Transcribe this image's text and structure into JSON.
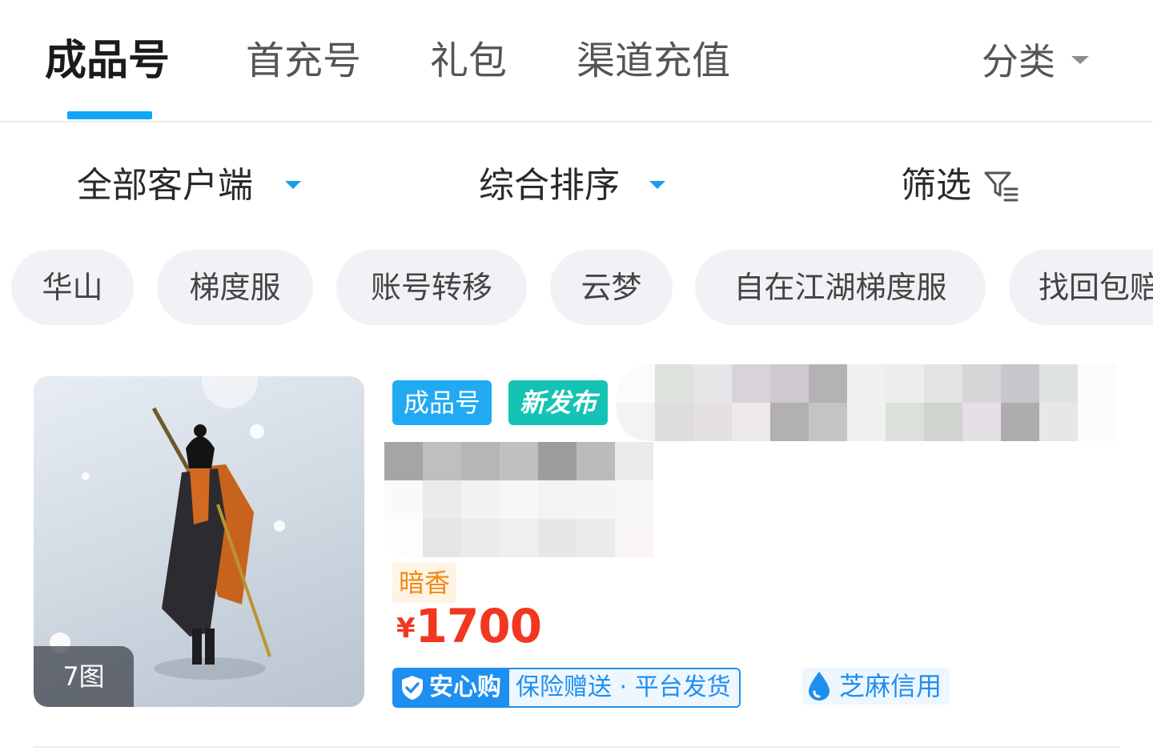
{
  "tabs": [
    {
      "label": "成品号",
      "active": true
    },
    {
      "label": "首充号",
      "active": false
    },
    {
      "label": "礼包",
      "active": false
    },
    {
      "label": "渠道充值",
      "active": false
    }
  ],
  "category": {
    "label": "分类",
    "icon": "caret-down-icon"
  },
  "filters": {
    "client": "全部客户端",
    "sort": "综合排序",
    "filter": "筛选",
    "filter_icon": "filter-funnel-icon"
  },
  "chips": [
    "华山",
    "梯度服",
    "账号转移",
    "云梦",
    "自在江湖梯度服",
    "找回包赔"
  ],
  "listing": {
    "image_count": "7图",
    "tags": {
      "type": "成品号",
      "new": "新发布"
    },
    "server": "暗香",
    "currency": "¥",
    "price": "1700",
    "assurance": {
      "badge": "安心购",
      "desc": "保险赠送 · 平台发货"
    },
    "credit": "芝麻信用"
  },
  "colors": {
    "accent": "#0fa7f5",
    "price": "#f2361f",
    "tag_new": "#15c3b4",
    "assure": "#1e8ff0"
  }
}
